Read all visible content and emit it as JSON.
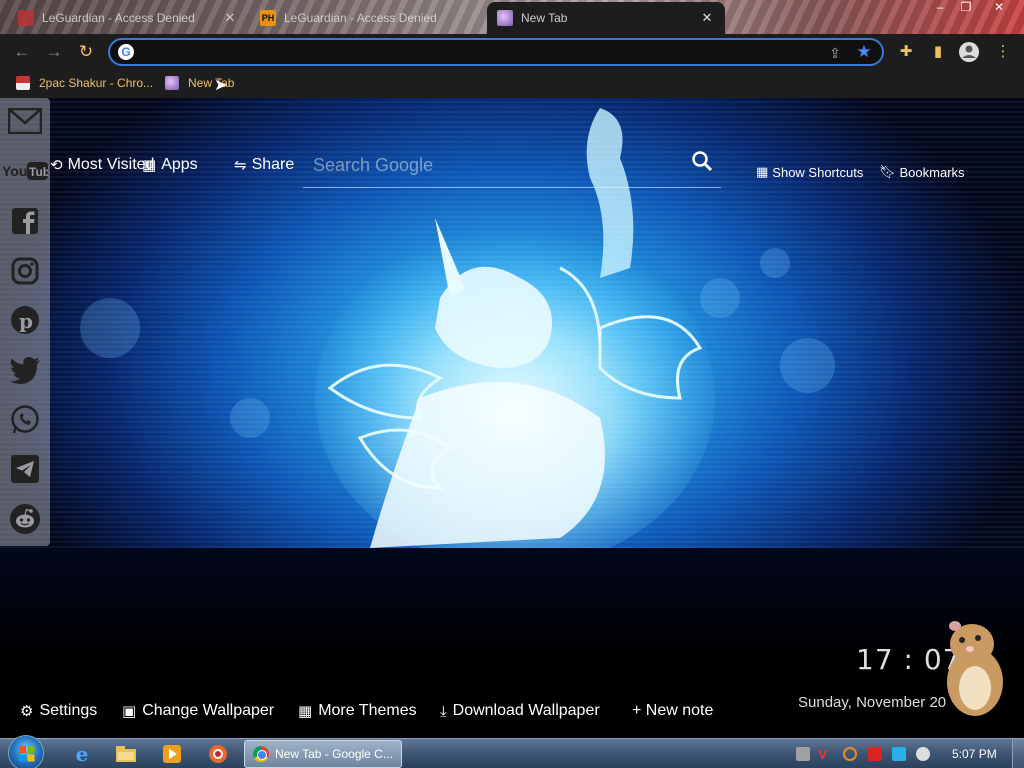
{
  "tabs": [
    {
      "title": "LeGuardian - Access Denied",
      "favicon": "red-app-icon",
      "active": false
    },
    {
      "title": "LeGuardian - Access Denied",
      "favicon": "ph-icon",
      "active": false
    },
    {
      "title": "New Tab",
      "favicon": "pony-icon",
      "active": true
    }
  ],
  "window_controls": {
    "minimize": "–",
    "maximize": "❐",
    "close": "✕"
  },
  "omnibox": {
    "value": "",
    "placeholder": ""
  },
  "bookmarks": [
    {
      "label": "2pac Shakur - Chro..."
    },
    {
      "label": "New Tab"
    }
  ],
  "ntp": {
    "most_visited": "Most Visited",
    "apps": "Apps",
    "share": "Share",
    "search_placeholder": "Search Google",
    "show_shortcuts": "Show Shortcuts",
    "bookmarks": "Bookmarks",
    "clock": "17 : 07",
    "date": "Sunday, November 20",
    "bottom": {
      "settings": "Settings",
      "change_wallpaper": "Change Wallpaper",
      "more_themes": "More Themes",
      "download_wallpaper": "Download Wallpaper",
      "new_note": "+ New note"
    }
  },
  "social": [
    "gmail-icon",
    "youtube-icon",
    "facebook-icon",
    "instagram-icon",
    "pinterest-icon",
    "twitter-icon",
    "whatsapp-icon",
    "telegram-icon",
    "reddit-icon"
  ],
  "taskbar": {
    "active_task": "New Tab - Google C...",
    "time": "5:07 PM"
  },
  "colors": {
    "accent_blue": "#3a78d9",
    "bookmark_text": "#f0c060",
    "wallpaper_glow": "#6fd8ff"
  }
}
